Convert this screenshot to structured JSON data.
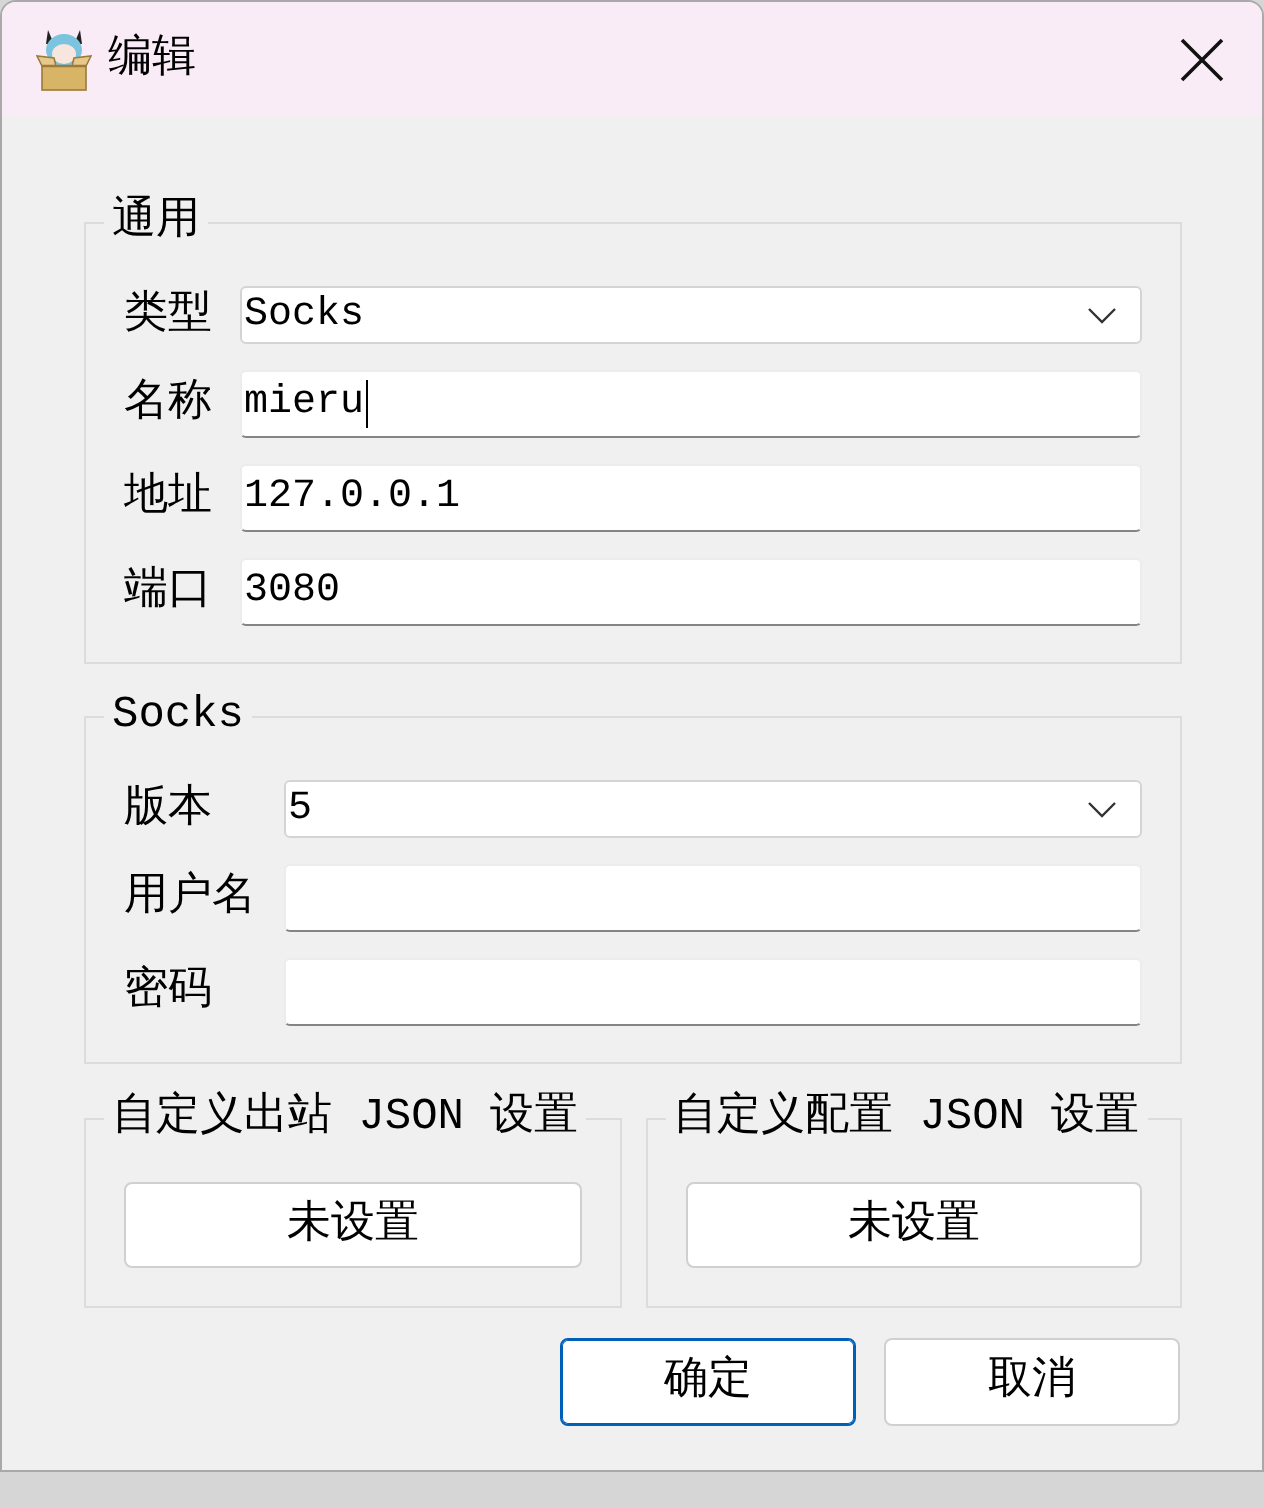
{
  "window": {
    "title": "编辑"
  },
  "general": {
    "title": "通用",
    "fields": [
      {
        "label": "类型",
        "kind": "select",
        "value": "Socks",
        "focused": false
      },
      {
        "label": "名称",
        "kind": "text",
        "value": "mieru",
        "focused": true
      },
      {
        "label": "地址",
        "kind": "text",
        "value": "127.0.0.1",
        "focused": false
      },
      {
        "label": "端口",
        "kind": "text",
        "value": "3080",
        "focused": false
      }
    ]
  },
  "socks": {
    "title": "Socks",
    "fields": [
      {
        "label": "版本",
        "kind": "select",
        "value": "5",
        "focused": false
      },
      {
        "label": "用户名",
        "kind": "text",
        "focused": false
      },
      {
        "label": "密码",
        "kind": "text",
        "focused": false
      }
    ]
  },
  "custom_groups": [
    {
      "title": "自定义出站 JSON 设置",
      "button": "未设置"
    },
    {
      "title": "自定义配置 JSON 设置",
      "button": "未设置"
    }
  ],
  "buttons": [
    {
      "label": "确定",
      "default": true
    },
    {
      "label": "取消",
      "default": false
    }
  ]
}
